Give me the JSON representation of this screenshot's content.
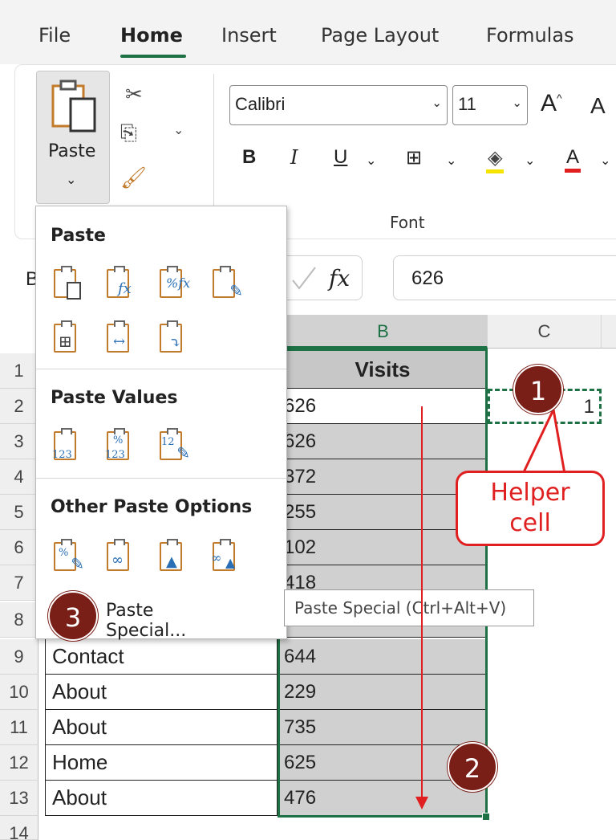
{
  "menu_tabs": [
    "File",
    "Home",
    "Insert",
    "Page Layout",
    "Formulas"
  ],
  "ribbon": {
    "paste_label": "Paste",
    "font_name": "Calibri",
    "font_size": "11",
    "bold": "B",
    "italic": "I",
    "underline": "U",
    "font_color_letter": "A",
    "font_group_label": "Font",
    "grow_font": "A",
    "shrink_font": "A"
  },
  "formula_bar": {
    "name_box_fragment": "B",
    "fx": "fx",
    "value": "626"
  },
  "paste_menu": {
    "heading_paste": "Paste",
    "heading_values": "Paste Values",
    "heading_other": "Other Paste Options",
    "paste_special": "Paste Special...",
    "tooltip": "Paste Special (Ctrl+Alt+V)",
    "values_sub": "123"
  },
  "grid": {
    "col_b": "B",
    "col_c": "C",
    "visits_header": "Visits",
    "rows": [
      {
        "num": "1",
        "a": "",
        "b": ""
      },
      {
        "num": "2",
        "a": "",
        "b": "626"
      },
      {
        "num": "3",
        "a": "",
        "b": "626"
      },
      {
        "num": "4",
        "a": "",
        "b": "372"
      },
      {
        "num": "5",
        "a": "",
        "b": "255"
      },
      {
        "num": "6",
        "a": "",
        "b": "102"
      },
      {
        "num": "7",
        "a": "",
        "b": "418"
      },
      {
        "num": "8",
        "a": "",
        "b": ""
      },
      {
        "num": "9",
        "a": "Contact",
        "b": "644"
      },
      {
        "num": "10",
        "a": "About",
        "b": "229"
      },
      {
        "num": "11",
        "a": "About",
        "b": "735"
      },
      {
        "num": "12",
        "a": "Home",
        "b": "625"
      },
      {
        "num": "13",
        "a": "About",
        "b": "476"
      },
      {
        "num": "14",
        "a": "",
        "b": ""
      }
    ],
    "helper_value": "1"
  },
  "annotations": {
    "badge_1": "1",
    "badge_2": "2",
    "badge_3": "3",
    "callout_line1": "Helper",
    "callout_line2": "cell",
    "accent_color": "#e02020",
    "badge_color": "#7a1e18",
    "selection_color": "#1e7145"
  }
}
